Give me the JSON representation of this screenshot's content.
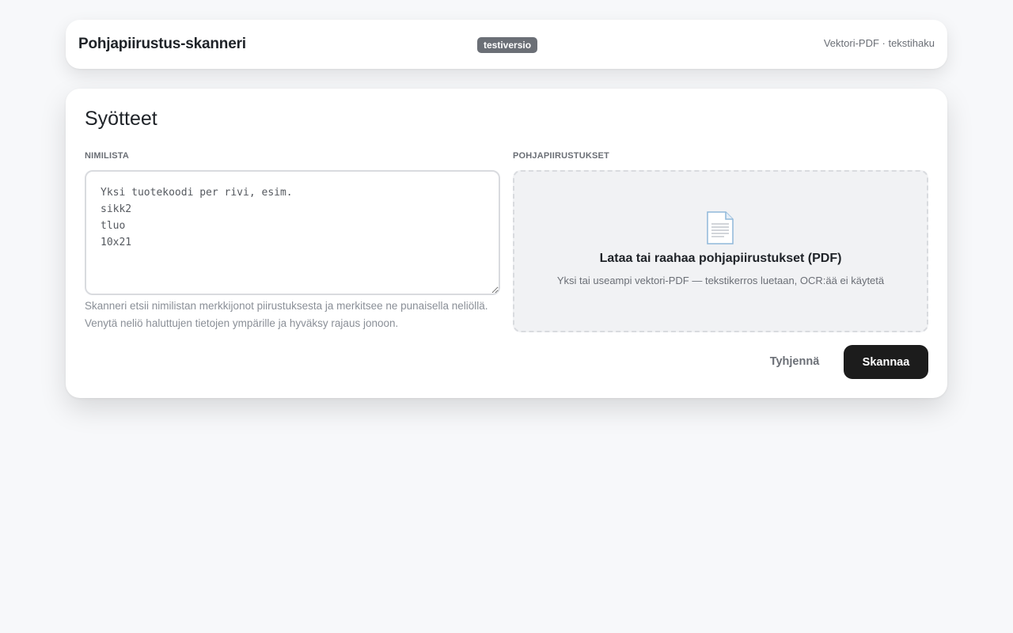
{
  "header": {
    "title": "Pohjapiirustus-skanneri",
    "badge": "testiversio",
    "meta": "Vektori-PDF · tekstihaku"
  },
  "inputs_card": {
    "title": "Syötteet",
    "names": {
      "label": "NIMILISTA",
      "placeholder": "Yksi tuotekoodi per rivi, esim.\nsikk2\ntluo\n10x21",
      "value": "",
      "hint": "Skanneri etsii nimilistan merkkijonot piirustuksesta ja merkitsee ne punaisella neliöllä. Venytä neliö haluttujen tietojen ympärille ja hyväksy rajaus jonoon."
    },
    "drawings": {
      "label": "POHJAPIIRUSTUKSET",
      "icon": "document-icon",
      "title": "Lataa tai raahaa pohjapiirustukset (PDF)",
      "subtitle": "Yksi tai useampi vektori-PDF — tekstikerros luetaan, OCR:ää ei käytetä"
    },
    "actions": {
      "clear_label": "Tyhjennä",
      "scan_label": "Skannaa"
    }
  }
}
